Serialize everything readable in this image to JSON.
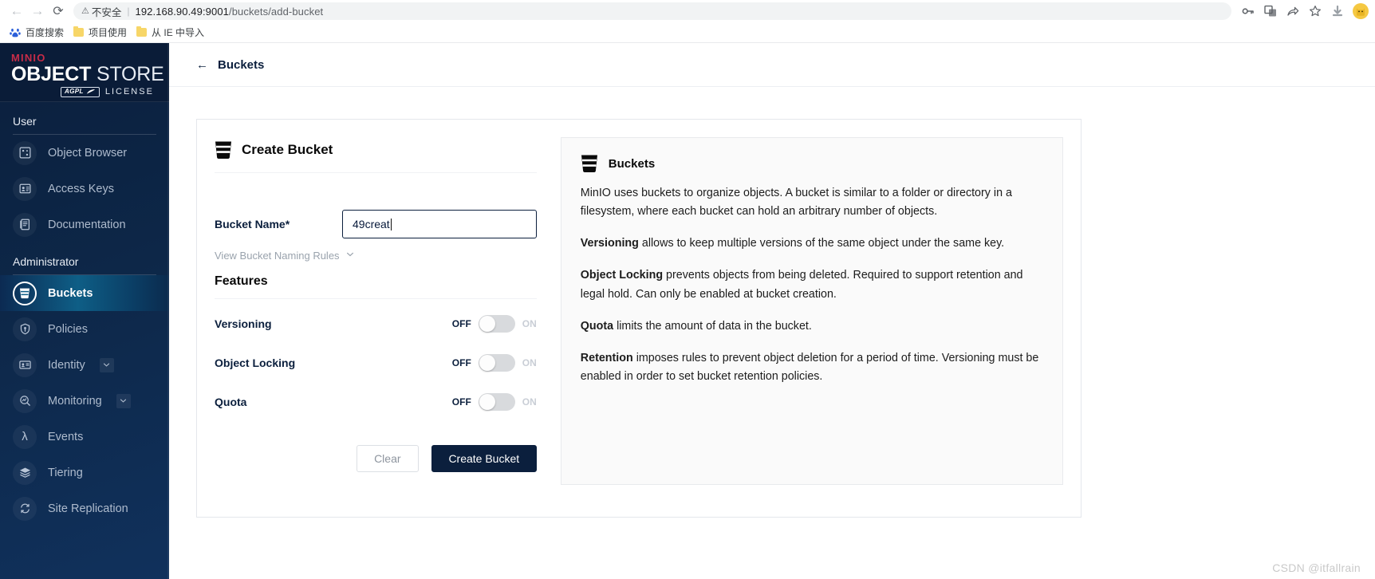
{
  "browser": {
    "back_icon": "back-arrow",
    "forward_icon": "forward-arrow",
    "reload_icon": "reload",
    "security_warning": "不安全",
    "url_host": "192.168.90.49:9001",
    "url_path": "/buckets/add-bucket",
    "toolbar_icons": [
      "key-icon",
      "translate-icon",
      "share-icon",
      "star-icon",
      "download-icon"
    ],
    "profile_icon": "cat-avatar-icon",
    "bookmarks": [
      {
        "label": "百度搜索",
        "icon": "baidu-icon"
      },
      {
        "label": "项目使用",
        "icon": "folder-icon"
      },
      {
        "label": "从 IE 中导入",
        "icon": "folder-icon"
      }
    ]
  },
  "sidebar": {
    "logo": {
      "brand": "MINIO",
      "title_bold": "OBJECT",
      "title_light": " STORE",
      "badge": "AGPL",
      "license": "LICENSE"
    },
    "sections": [
      {
        "title": "User",
        "items": [
          {
            "label": "Object Browser",
            "icon": "object-browser-icon",
            "active": false,
            "chevron": false
          },
          {
            "label": "Access Keys",
            "icon": "access-keys-icon",
            "active": false,
            "chevron": false
          },
          {
            "label": "Documentation",
            "icon": "documentation-icon",
            "active": false,
            "chevron": false
          }
        ]
      },
      {
        "title": "Administrator",
        "items": [
          {
            "label": "Buckets",
            "icon": "bucket-icon",
            "active": true,
            "chevron": false
          },
          {
            "label": "Policies",
            "icon": "policies-icon",
            "active": false,
            "chevron": false
          },
          {
            "label": "Identity",
            "icon": "identity-icon",
            "active": false,
            "chevron": true
          },
          {
            "label": "Monitoring",
            "icon": "monitoring-icon",
            "active": false,
            "chevron": true
          },
          {
            "label": "Events",
            "icon": "lambda-icon",
            "active": false,
            "chevron": false
          },
          {
            "label": "Tiering",
            "icon": "tiering-icon",
            "active": false,
            "chevron": false
          },
          {
            "label": "Site Replication",
            "icon": "site-replication-icon",
            "active": false,
            "chevron": false
          }
        ]
      }
    ]
  },
  "header": {
    "back_icon": "back-arrow-icon",
    "breadcrumb": "Buckets"
  },
  "form": {
    "title": "Create Bucket",
    "title_icon": "bucket-icon",
    "bucket_name_label": "Bucket Name*",
    "bucket_name_value": "49creat",
    "bucket_name_placeholder": "",
    "naming_rules_label": "View Bucket Naming Rules",
    "features_title": "Features",
    "features": [
      {
        "label": "Versioning",
        "off_label": "OFF",
        "on_label": "ON",
        "state": "off"
      },
      {
        "label": "Object Locking",
        "off_label": "OFF",
        "on_label": "ON",
        "state": "off"
      },
      {
        "label": "Quota",
        "off_label": "OFF",
        "on_label": "ON",
        "state": "off"
      }
    ],
    "clear_label": "Clear",
    "submit_label": "Create Bucket"
  },
  "help": {
    "title": "Buckets",
    "title_icon": "bucket-icon",
    "paragraphs": [
      {
        "lead": "",
        "text": "MinIO uses buckets to organize objects. A bucket is similar to a folder or directory in a filesystem, where each bucket can hold an arbitrary number of objects."
      },
      {
        "lead": "Versioning",
        "text": " allows to keep multiple versions of the same object under the same key."
      },
      {
        "lead": "Object Locking",
        "text": " prevents objects from being deleted. Required to support retention and legal hold. Can only be enabled at bucket creation."
      },
      {
        "lead": "Quota",
        "text": " limits the amount of data in the bucket."
      },
      {
        "lead": "Retention",
        "text": " imposes rules to prevent object deletion for a period of time. Versioning must be enabled in order to set bucket retention policies."
      }
    ]
  },
  "watermark": "CSDN @itfallrain",
  "colors": {
    "sidebar_bg": "#0b1f3d",
    "accent_active": "#0e5e86",
    "brand_red": "#c72c48",
    "primary_button": "#0b1f3d"
  }
}
